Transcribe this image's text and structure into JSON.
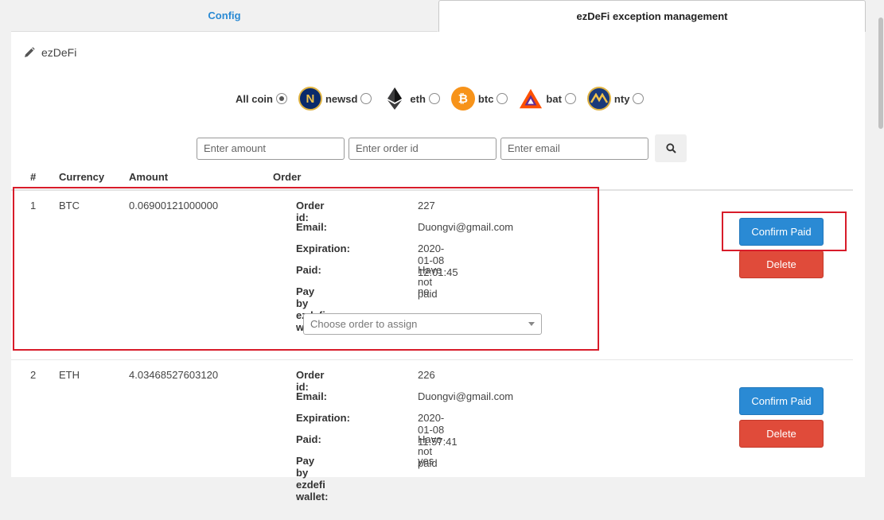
{
  "tabs": [
    {
      "label": "Config"
    },
    {
      "label": "ezDeFi exception management"
    }
  ],
  "section": {
    "title": "ezDeFi"
  },
  "filters": {
    "all_label": "All coin",
    "coins": [
      {
        "label": "newsd",
        "icon": "newsd-coin-icon",
        "color": "#0a2a6b"
      },
      {
        "label": "eth",
        "icon": "ethereum-icon",
        "color": "#3c3c3d"
      },
      {
        "label": "btc",
        "icon": "bitcoin-icon",
        "color": "#f7931a"
      },
      {
        "label": "bat",
        "icon": "bat-token-icon",
        "color": "#ff5000"
      },
      {
        "label": "nty",
        "icon": "nty-coin-icon",
        "color": "#1a3a7a"
      }
    ],
    "selected": "All coin"
  },
  "search": {
    "amount_placeholder": "Enter amount",
    "order_placeholder": "Enter order id",
    "email_placeholder": "Enter email"
  },
  "table": {
    "headers": {
      "num": "#",
      "currency": "Currency",
      "amount": "Amount",
      "order": "Order"
    },
    "detail_labels": {
      "order_id": "Order id:",
      "email": "Email:",
      "expiration": "Expiration:",
      "paid": "Paid:",
      "wallet": "Pay by ezdefi wallet:"
    },
    "rows": [
      {
        "num": "1",
        "currency": "BTC",
        "amount": "0.06900121000000",
        "order_id": "227",
        "email": "Duongvi@gmail.com",
        "expiration": "2020-01-08 12:01:45",
        "paid": "Have not paid",
        "wallet": "no",
        "assign_placeholder": "Choose order to assign",
        "confirm_label": "Confirm Paid",
        "delete_label": "Delete"
      },
      {
        "num": "2",
        "currency": "ETH",
        "amount": "4.03468527603120",
        "order_id": "226",
        "email": "Duongvi@gmail.com",
        "expiration": "2020-01-08 11:57:41",
        "paid": "Have not paid",
        "wallet": "yes",
        "confirm_label": "Confirm Paid",
        "delete_label": "Delete"
      }
    ]
  },
  "colors": {
    "accent": "#2a8ad4",
    "danger": "#e04b3a",
    "highlight": "#d81c2a"
  }
}
